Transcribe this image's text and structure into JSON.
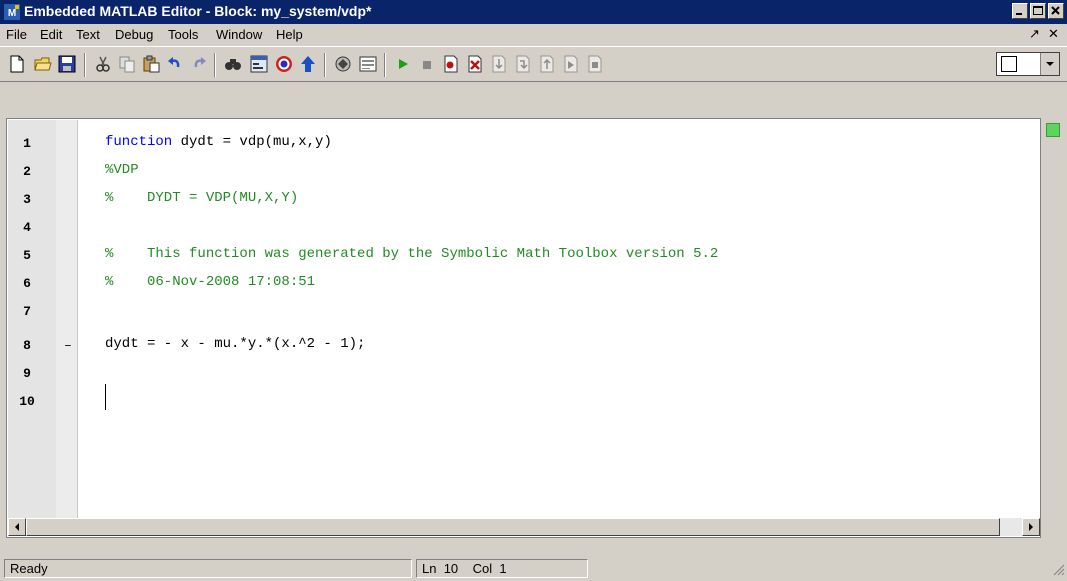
{
  "window": {
    "title": "Embedded MATLAB Editor - Block: my_system/vdp*",
    "title_bar_color": "#0a246a"
  },
  "menu": {
    "items": [
      "File",
      "Edit",
      "Text",
      "Debug",
      "Tools",
      "Window",
      "Help"
    ],
    "undock_glyph": "↗",
    "close_glyph": "✕"
  },
  "toolbar": {
    "icons": [
      "new-file-icon",
      "open-folder-icon",
      "save-icon",
      "cut-icon",
      "copy-icon",
      "paste-icon",
      "undo-icon",
      "redo-icon",
      "find-icon",
      "model-explorer-icon",
      "target-icon",
      "go-to-icon",
      "build-icon",
      "data-type-icon",
      "run-icon",
      "stop-icon",
      "set-breakpoint-icon",
      "clear-breakpoint-icon",
      "step-icon",
      "step-in-icon",
      "step-out-icon",
      "continue-icon",
      "exit-debug-icon"
    ]
  },
  "editor": {
    "line_numbers": [
      "1",
      "2",
      "3",
      "4",
      "5",
      "6",
      "7",
      "8",
      "9",
      "10"
    ],
    "breakpoint_dash": "–",
    "code": {
      "l1_kw": "function",
      "l1_rest": " dydt = vdp(mu,x,y)",
      "l2": "%VDP",
      "l3": "%    DYDT = VDP(MU,X,Y)",
      "l5": "%    This function was generated by the Symbolic Math Toolbox version 5.2",
      "l6": "%    06-Nov-2008 17:08:51",
      "l8": "dydt = - x - mu.*y.*(x.^2 - 1);"
    },
    "keyword_color": "#0000ff",
    "comment_color": "#228b22",
    "mlint_color": "#5fd35f"
  },
  "status": {
    "state": "Ready",
    "ln_label": "Ln",
    "ln_value": "10",
    "col_label": "Col",
    "col_value": "1"
  }
}
